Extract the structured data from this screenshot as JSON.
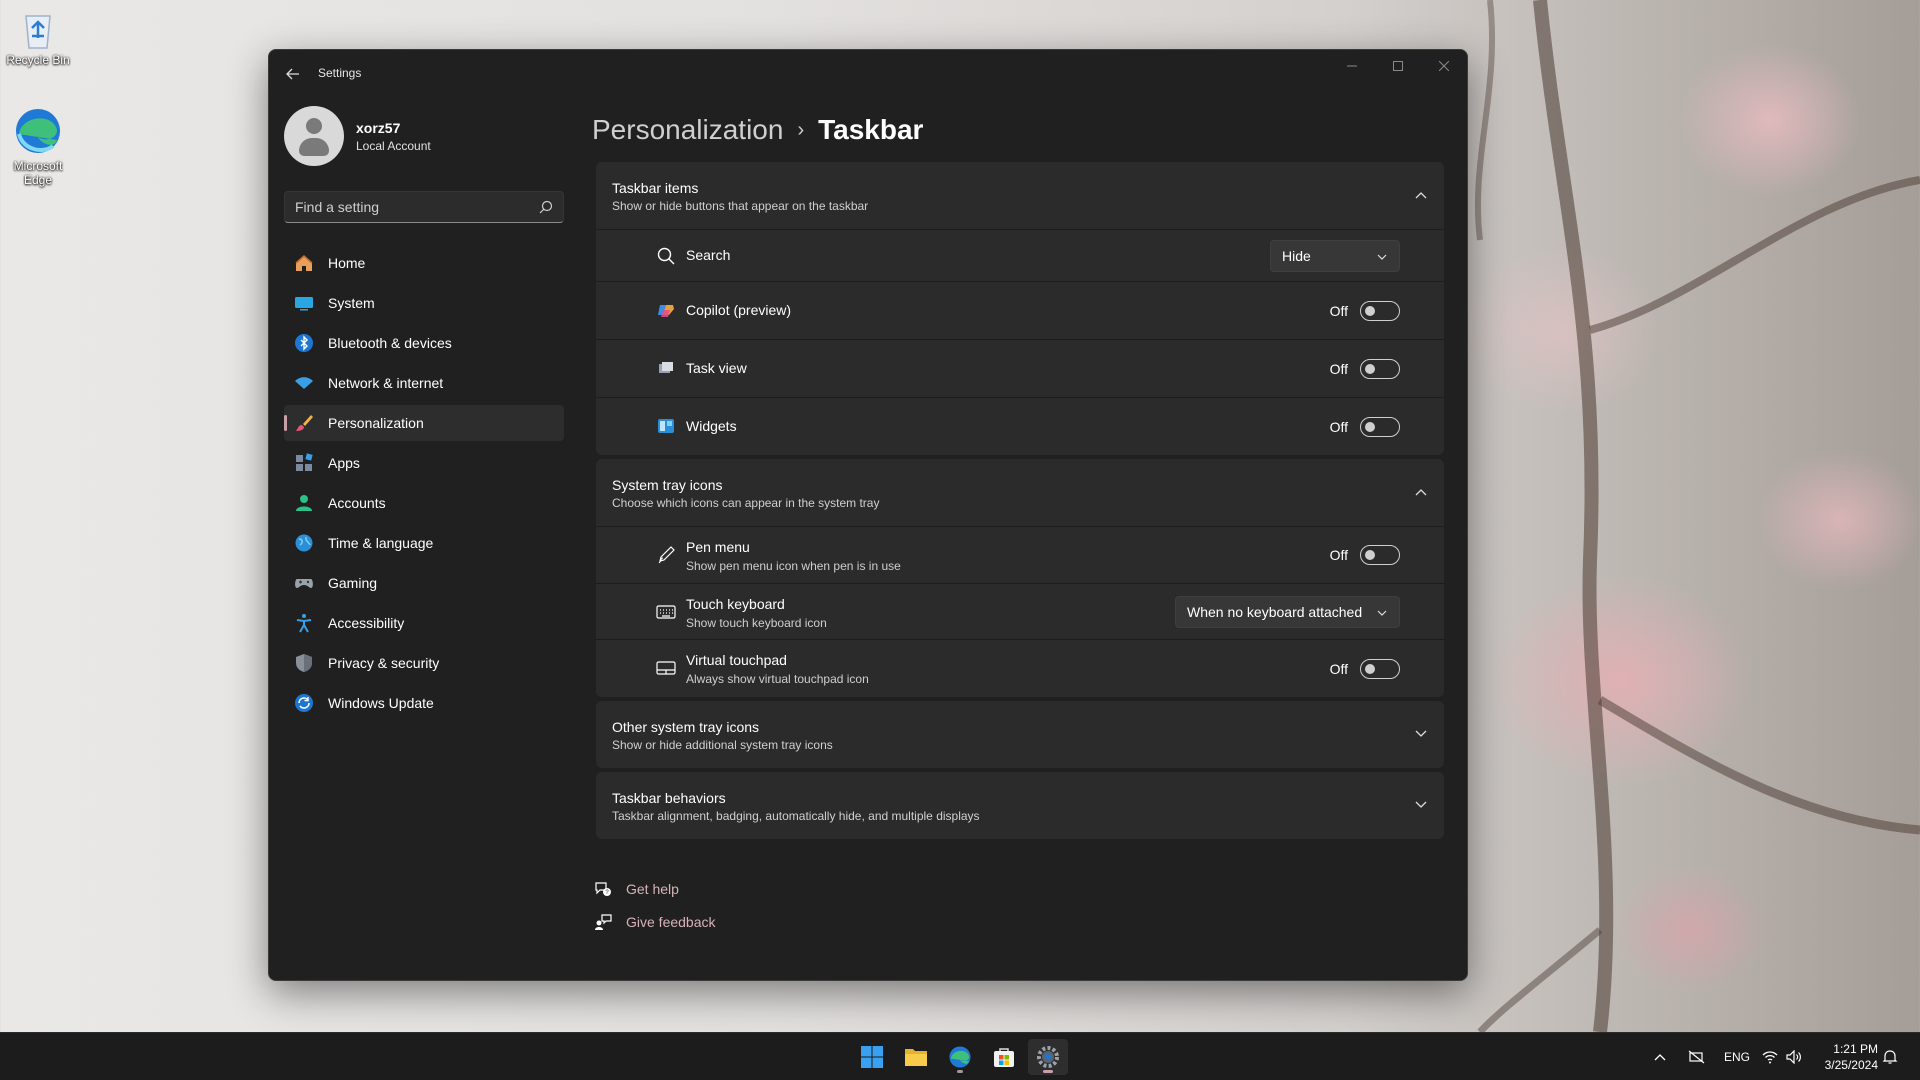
{
  "desktop": {
    "recycle_bin": "Recycle Bin",
    "edge": "Microsoft Edge"
  },
  "window": {
    "title": "Settings",
    "controls": {
      "minimize": "minimize",
      "maximize": "maximize",
      "close": "close"
    }
  },
  "profile": {
    "name": "xorz57",
    "account": "Local Account"
  },
  "search": {
    "placeholder": "Find a setting"
  },
  "nav": [
    {
      "label": "Home",
      "icon": "home-icon"
    },
    {
      "label": "System",
      "icon": "system-icon"
    },
    {
      "label": "Bluetooth & devices",
      "icon": "bluetooth-icon"
    },
    {
      "label": "Network & internet",
      "icon": "wifi-icon"
    },
    {
      "label": "Personalization",
      "icon": "brush-icon",
      "active": true
    },
    {
      "label": "Apps",
      "icon": "apps-icon"
    },
    {
      "label": "Accounts",
      "icon": "person-icon"
    },
    {
      "label": "Time & language",
      "icon": "globe-icon"
    },
    {
      "label": "Gaming",
      "icon": "controller-icon"
    },
    {
      "label": "Accessibility",
      "icon": "accessibility-icon"
    },
    {
      "label": "Privacy & security",
      "icon": "shield-icon"
    },
    {
      "label": "Windows Update",
      "icon": "update-icon"
    }
  ],
  "breadcrumb": {
    "parent": "Personalization",
    "separator": "›",
    "current": "Taskbar"
  },
  "taskbar_items": {
    "title": "Taskbar items",
    "subtitle": "Show or hide buttons that appear on the taskbar",
    "rows": [
      {
        "label": "Search",
        "icon": "search-icon",
        "dropdown": "Hide"
      },
      {
        "label": "Copilot (preview)",
        "icon": "copilot-icon",
        "state": "Off"
      },
      {
        "label": "Task view",
        "icon": "task-view-icon",
        "state": "Off"
      },
      {
        "label": "Widgets",
        "icon": "widgets-icon",
        "state": "Off"
      }
    ]
  },
  "system_tray": {
    "title": "System tray icons",
    "subtitle": "Choose which icons can appear in the system tray",
    "rows": [
      {
        "label": "Pen menu",
        "desc": "Show pen menu icon when pen is in use",
        "icon": "pen-icon",
        "state": "Off"
      },
      {
        "label": "Touch keyboard",
        "desc": "Show touch keyboard icon",
        "icon": "keyboard-icon",
        "dropdown": "When no keyboard attached"
      },
      {
        "label": "Virtual touchpad",
        "desc": "Always show virtual touchpad icon",
        "icon": "touchpad-icon",
        "state": "Off"
      }
    ]
  },
  "other_tray": {
    "title": "Other system tray icons",
    "subtitle": "Show or hide additional system tray icons"
  },
  "behaviors": {
    "title": "Taskbar behaviors",
    "subtitle": "Taskbar alignment, badging, automatically hide, and multiple displays"
  },
  "links": {
    "help": "Get help",
    "feedback": "Give feedback"
  },
  "taskbar": {
    "apps": [
      "start-icon",
      "file-explorer-icon",
      "edge-icon",
      "store-icon",
      "settings-icon"
    ],
    "lang": "ENG",
    "time": "1:21 PM",
    "date": "3/25/2024"
  },
  "colors": {
    "accent": "#c8a2a6",
    "window_bg": "#202020",
    "card_bg": "#2b2b2b",
    "link": "#d7b3b8"
  }
}
